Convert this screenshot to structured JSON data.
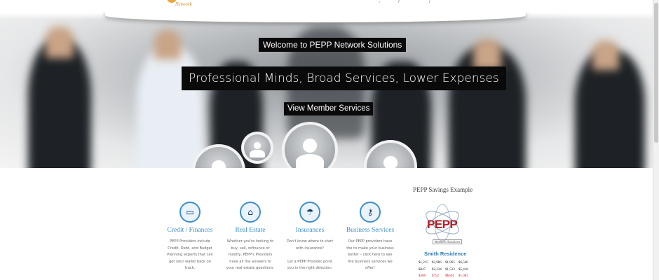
{
  "header": {
    "logo_sub": "Network",
    "nav_fragments": [
      ",",
      "/",
      "/"
    ]
  },
  "hero": {
    "welcome": "Welcome to PEPP Network Solutions",
    "tagline": "Professional Minds, Broad Services, Lower Expenses",
    "cta": "View Member Services"
  },
  "services": [
    {
      "icon": "credit-card-icon",
      "glyph": "▭",
      "title": "Credit / Finances",
      "desc": [
        "PEPP Providers include",
        "Credit, Debt, and Budget",
        "Planning experts that can",
        "get your wallet back on",
        "track."
      ]
    },
    {
      "icon": "home-icon",
      "glyph": "⌂",
      "title": "Real Estate",
      "desc": [
        "Whether you're looking to",
        "buy, sell, refinance or",
        "modify, PEPP's Providers",
        "have all the answers to",
        "your real-estate questions."
      ]
    },
    {
      "icon": "umbrella-icon",
      "glyph": "☂",
      "title": "Insurances",
      "desc": [
        "Don't know where to start",
        "with insurance?",
        "",
        "Let a PEPP Provider point",
        "you in the right direction."
      ]
    },
    {
      "icon": "key-icon",
      "glyph": "⚷",
      "title": "Business Services",
      "desc": [
        "Our PEPP providers have",
        "the to make your business",
        "better – click here to see",
        "the business services we",
        "offer!"
      ]
    }
  ],
  "savings": {
    "title": "PEPP Savings Example",
    "logo_text": "PEPP",
    "logo_sub": "Network Solutions",
    "residence": "Smith Residence",
    "rows": [
      [
        "$1,215",
        "$2,986",
        "$1,965",
        "$6,500"
      ],
      [
        "$847",
        "$2,234",
        "$1,523",
        "$5,418"
      ],
      [
        "$368",
        "$752",
        "$$504",
        "$1,082"
      ]
    ]
  },
  "colors": {
    "accent": "#3d8fc9",
    "brand_red": "#b21f24",
    "banner_bg": "#0a0a0a"
  }
}
